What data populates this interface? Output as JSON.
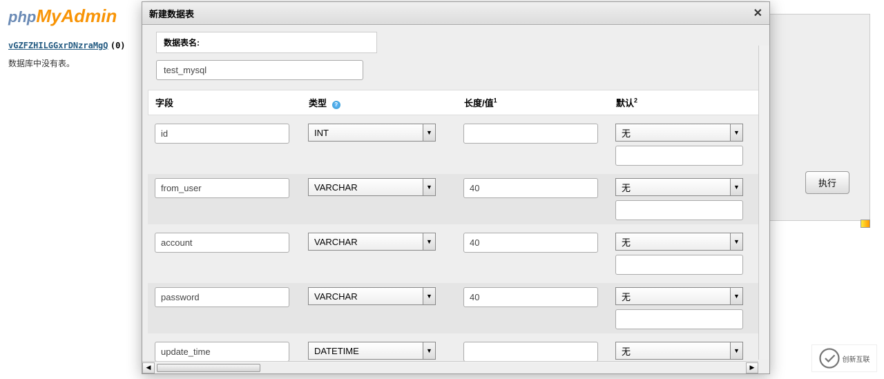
{
  "sidebar": {
    "db_link": "vGZFZHILGGxrDNzraMgQ",
    "db_count": "(0)",
    "db_empty": "数据库中没有表。"
  },
  "logo": {
    "php": "php",
    "my": "My",
    "admin": "Admin"
  },
  "main": {
    "execute": "执行"
  },
  "dialog": {
    "title": "新建数据表",
    "tablename_label": "数据表名:",
    "tablename_value": "test_mysql",
    "headers": {
      "field": "字段",
      "type": "类型",
      "length": "长度/值",
      "length_sup": "1",
      "default": "默认",
      "default_sup": "2"
    },
    "rows": [
      {
        "field": "id",
        "type": "INT",
        "length": "",
        "default": "无"
      },
      {
        "field": "from_user",
        "type": "VARCHAR",
        "length": "40",
        "default": "无"
      },
      {
        "field": "account",
        "type": "VARCHAR",
        "length": "40",
        "default": "无"
      },
      {
        "field": "password",
        "type": "VARCHAR",
        "length": "40",
        "default": "无"
      },
      {
        "field": "update_time",
        "type": "DATETIME",
        "length": "",
        "default": "无"
      }
    ]
  },
  "brand": {
    "text": "创新互联"
  }
}
